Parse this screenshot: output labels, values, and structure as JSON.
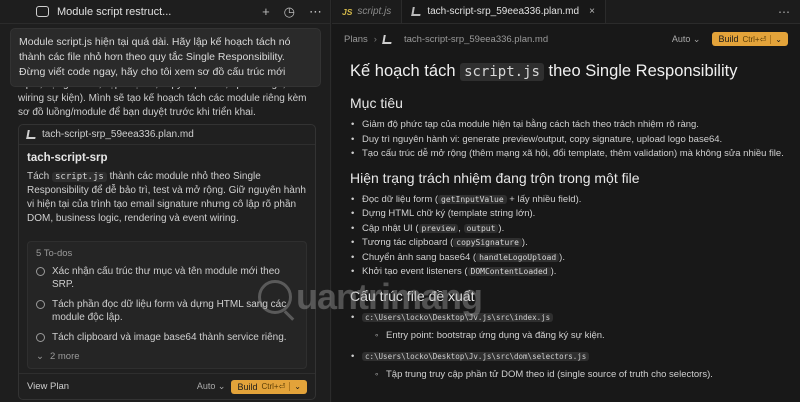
{
  "left": {
    "chat_title": "Module script restruct...",
    "user_message": "Module script.js hiện tại quá dài. Hãy lập kế hoạch tách nó thành các file nhỏ hơn theo quy tắc Single Responsibility. Đừng viết code ngay, hãy cho tôi xem sơ đồ cấu trúc mới",
    "assistant_text": "input, dựng HTML, cập nhật UI, copy clipboard, upload logo, và wiring sự kiện). Mình sẽ tạo kế hoạch tách các module riêng kèm sơ đồ luồng/module để bạn duyệt trước khi triển khai.",
    "plan_card": {
      "file": "tach-script-srp_59eea336.plan.md",
      "title": "tach-script-srp",
      "desc_before": "Tách ",
      "desc_code": "script.js",
      "desc_after": " thành các module nhỏ theo Single Responsibility để dễ bảo trì, test và mở rộng. Giữ nguyên hành vi hiện tại của trình tạo email signature nhưng cô lập rõ phần DOM, business logic, rendering và event wiring.",
      "todos_header": "5 To-dos",
      "todos": [
        "Xác nhận cấu trúc thư mục và tên module mới theo SRP.",
        "Tách phần đọc dữ liệu form và dựng HTML sang các module độc lập.",
        "Tách clipboard và image base64 thành service riêng."
      ],
      "more": "2 more",
      "view_plan": "View Plan",
      "auto": "Auto",
      "build": "Build",
      "build_shortcut": "Ctrl+⏎"
    }
  },
  "right": {
    "tabs": [
      {
        "badge": "JS",
        "label": "script.js"
      },
      {
        "label": "tach-script-srp_59eea336.plan.md"
      }
    ],
    "breadcrumb": [
      "Plans",
      "tach-script-srp_59eea336.plan.md"
    ],
    "auto": "Auto",
    "build": "Build",
    "build_shortcut": "Ctrl+⏎",
    "doc": {
      "h1_before": "Kế hoạch tách ",
      "h1_code": "script.js",
      "h1_after": " theo Single Responsibility",
      "goal_heading": "Mục tiêu",
      "goals": [
        "Giảm độ phức tạp của module hiện tại bằng cách tách theo trách nhiệm rõ ràng.",
        "Duy trì nguyên hành vi: generate preview/output, copy signature, upload logo base64.",
        "Tạo cấu trúc dễ mở rộng (thêm mạng xã hội, đổi template, thêm validation) mà không sửa nhiều file."
      ],
      "current_heading": "Hiện trạng trách nhiệm đang trộn trong một file",
      "current": [
        {
          "before": "Đọc dữ liệu form (",
          "code": "getInputValue",
          "after": " + lấy nhiều field)."
        },
        {
          "before": "Dựng HTML chữ ký (template string lớn).",
          "code": "",
          "after": ""
        },
        {
          "before": "Cập nhật UI (",
          "code": "preview",
          "mid": ", ",
          "code2": "output",
          "after": ")."
        },
        {
          "before": "Tương tác clipboard (",
          "code": "copySignature",
          "after": ")."
        },
        {
          "before": "Chuyển ảnh sang base64 (",
          "code": "handleLogoUpload",
          "after": ")."
        },
        {
          "before": "Khởi tạo event listeners (",
          "code": "DOMContentLoaded",
          "after": ")."
        }
      ],
      "structure_heading": "Cấu trúc file đề xuất",
      "structure": [
        {
          "path": "c:\\Users\\locko\\Desktop\\Jv.js\\src\\index.js",
          "note": "Entry point: bootstrap ứng dụng và đăng ký sự kiện."
        },
        {
          "path": "c:\\Users\\locko\\Desktop\\Jv.js\\src\\dom\\selectors.js",
          "note": "Tập trung truy cập phần tử DOM theo id (single source of truth cho selectors)."
        }
      ]
    }
  },
  "watermark": "uantrimang",
  "colors": {
    "accent": "#e3a33a",
    "bg": "#181818",
    "panel": "#1e1e1e"
  }
}
